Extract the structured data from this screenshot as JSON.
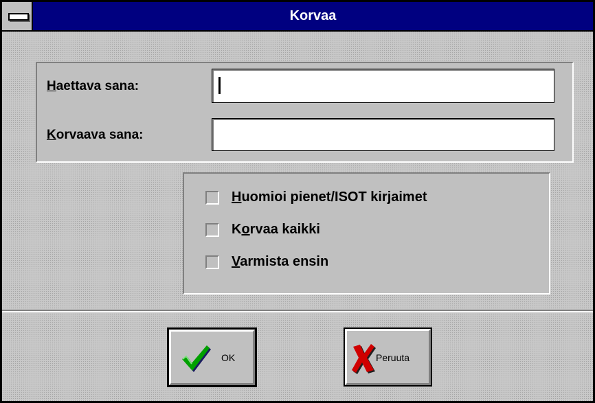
{
  "window": {
    "title": "Korvaa"
  },
  "fields": {
    "search": {
      "label_key": "H",
      "label_rest": "aettava sana:",
      "value": ""
    },
    "replace": {
      "label_key": "K",
      "label_rest": "orvaava sana:",
      "value": ""
    }
  },
  "options": [
    {
      "key": "H",
      "rest": "uomioi pienet/ISOT kirjaimet",
      "checked": false
    },
    {
      "pre": "K",
      "key": "o",
      "rest": "rvaa kaikki",
      "checked": false
    },
    {
      "key": "V",
      "rest": "armista ensin",
      "checked": false
    }
  ],
  "buttons": {
    "ok": {
      "label": "OK",
      "icon": "checkmark-icon"
    },
    "cancel": {
      "label": "Peruuta",
      "icon": "x-cross-icon"
    }
  },
  "colors": {
    "titlebar": "#000080",
    "check_green": "#00a000",
    "cross_red": "#d00000",
    "dialog_bg": "#c0c0c0"
  }
}
